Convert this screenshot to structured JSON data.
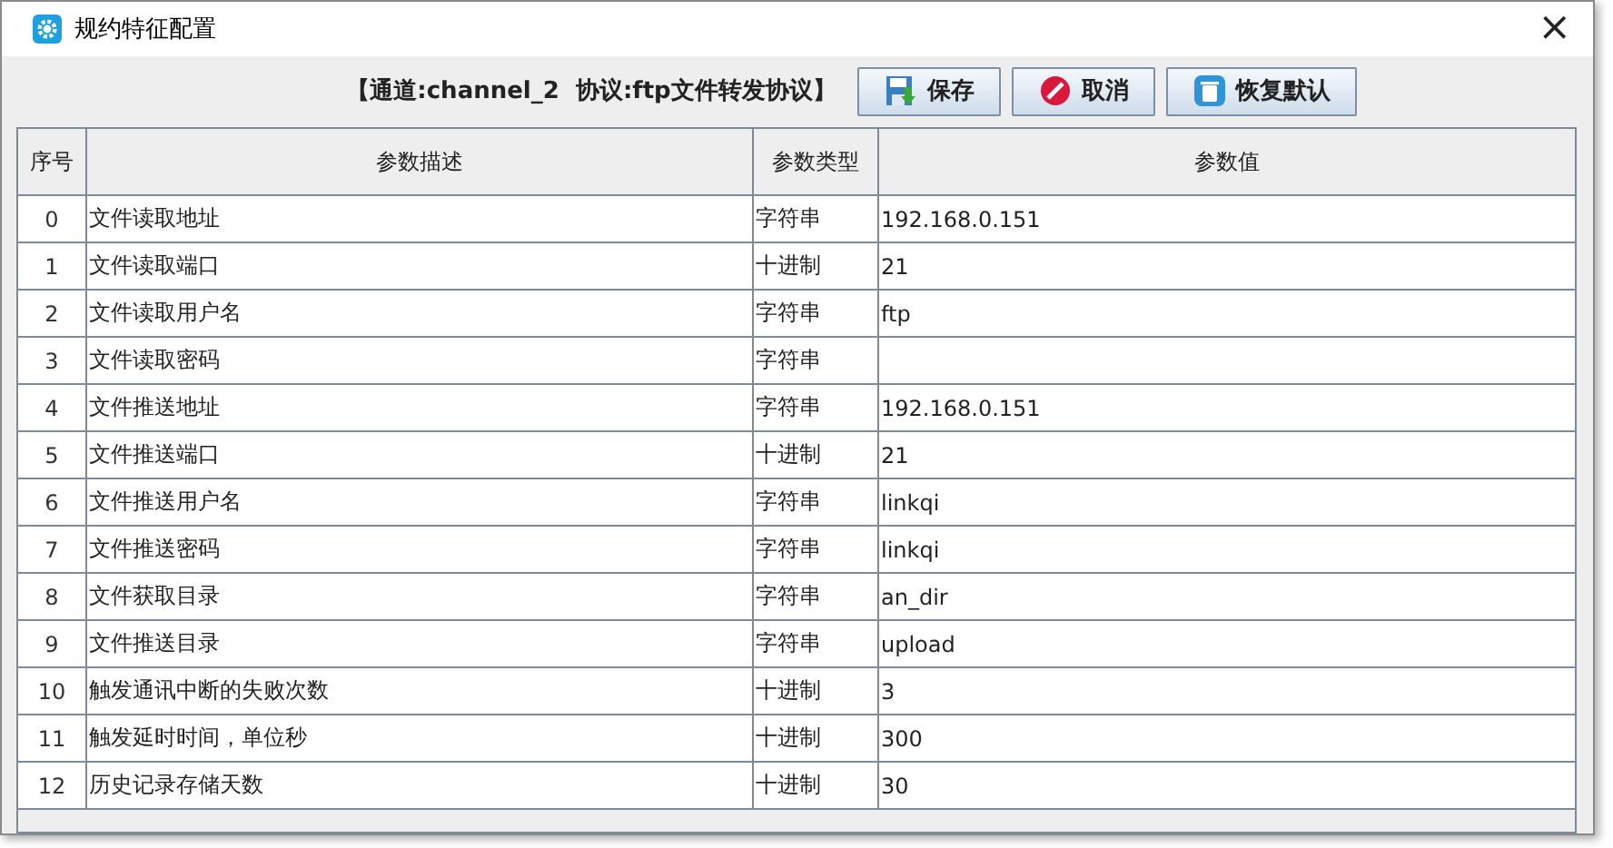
{
  "window": {
    "title": "规约特征配置",
    "close": "×"
  },
  "toolbar": {
    "caption": "【通道:channel_2  协议:ftp文件转发协议】",
    "buttons": [
      {
        "label": "保存",
        "kind": "save"
      },
      {
        "label": "取消",
        "kind": "cancel"
      },
      {
        "label": "恢复默认",
        "kind": "reset"
      }
    ]
  },
  "table": {
    "columns": [
      "序号",
      "参数描述",
      "参数类型",
      "参数值"
    ],
    "rows": [
      [
        "0",
        "文件读取地址",
        "字符串",
        "192.168.0.151"
      ],
      [
        "1",
        "文件读取端口",
        "十进制",
        "21"
      ],
      [
        "2",
        "文件读取用户名",
        "字符串",
        "ftp"
      ],
      [
        "3",
        "文件读取密码",
        "字符串",
        ""
      ],
      [
        "4",
        "文件推送地址",
        "字符串",
        "192.168.0.151"
      ],
      [
        "5",
        "文件推送端口",
        "十进制",
        "21"
      ],
      [
        "6",
        "文件推送用户名",
        "字符串",
        "linkqi"
      ],
      [
        "7",
        "文件推送密码",
        "字符串",
        "linkqi"
      ],
      [
        "8",
        "文件获取目录",
        "字符串",
        "an_dir"
      ],
      [
        "9",
        "文件推送目录",
        "字符串",
        "upload"
      ],
      [
        "10",
        "触发通讯中断的失败次数",
        "十进制",
        "3"
      ],
      [
        "11",
        "触发延时时间，单位秒",
        "十进制",
        "300"
      ],
      [
        "12",
        "历史记录存储天数",
        "十进制",
        "30"
      ]
    ]
  }
}
